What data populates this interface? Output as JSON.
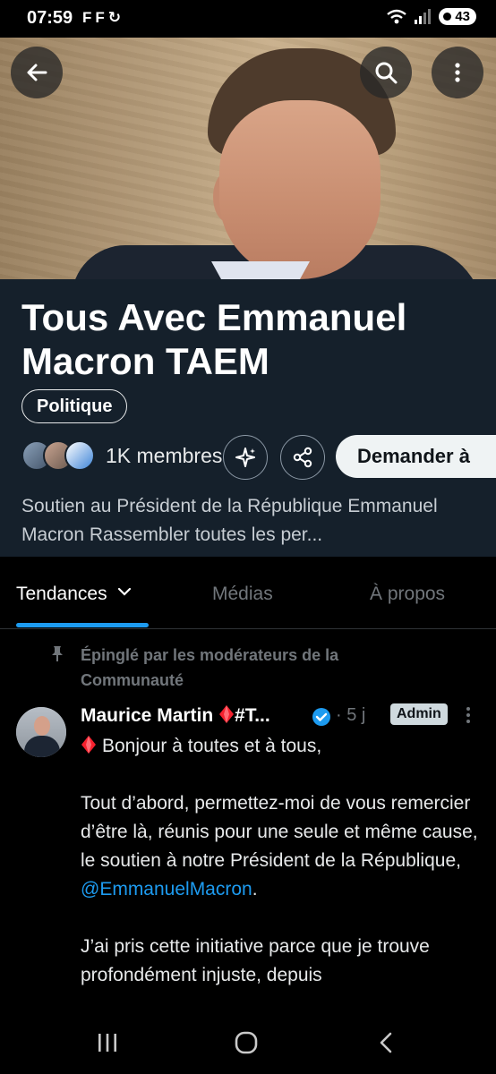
{
  "status_bar": {
    "time": "07:59",
    "notifications": [
      "F",
      "F",
      "↻"
    ],
    "battery": "43"
  },
  "community": {
    "title": "Tous Avec Emmanuel Macron TAEM",
    "category": "Politique",
    "members_label": "1K membres",
    "join_label": "Demander à",
    "description": "Soutien au Président de la République Emmanuel Macron Rassembler toutes les per..."
  },
  "tabs": [
    {
      "label": "Tendances",
      "active": true
    },
    {
      "label": "Médias",
      "active": false
    },
    {
      "label": "À propos",
      "active": false
    }
  ],
  "post": {
    "pinned_label": "Épinglé par les modérateurs de la Communauté",
    "author": "Maurice Martin",
    "author_suffix": "#T...",
    "time": "· 5 j",
    "badge": "Admin",
    "line1": "Bonjour à toutes et à tous,",
    "para2_before": "Tout d’abord, permettez-moi de vous remercier d’être là, réunis pour une seule et même cause, le soutien à notre Président de la République,",
    "mention": "@EmmanuelMacron",
    "para2_after": ".",
    "para3": "J’ai pris cette initiative parce que je trouve profondément injuste, depuis"
  },
  "colors": {
    "accent": "#1d9bf0",
    "header_bg": "#15202b",
    "diamond": "#f4212e"
  },
  "icons": [
    "back-arrow-icon",
    "search-icon",
    "more-vertical-icon",
    "sparkle-icon",
    "share-icon",
    "chevron-down-icon",
    "pin-icon",
    "verified-badge-icon",
    "red-diamond-icon"
  ]
}
